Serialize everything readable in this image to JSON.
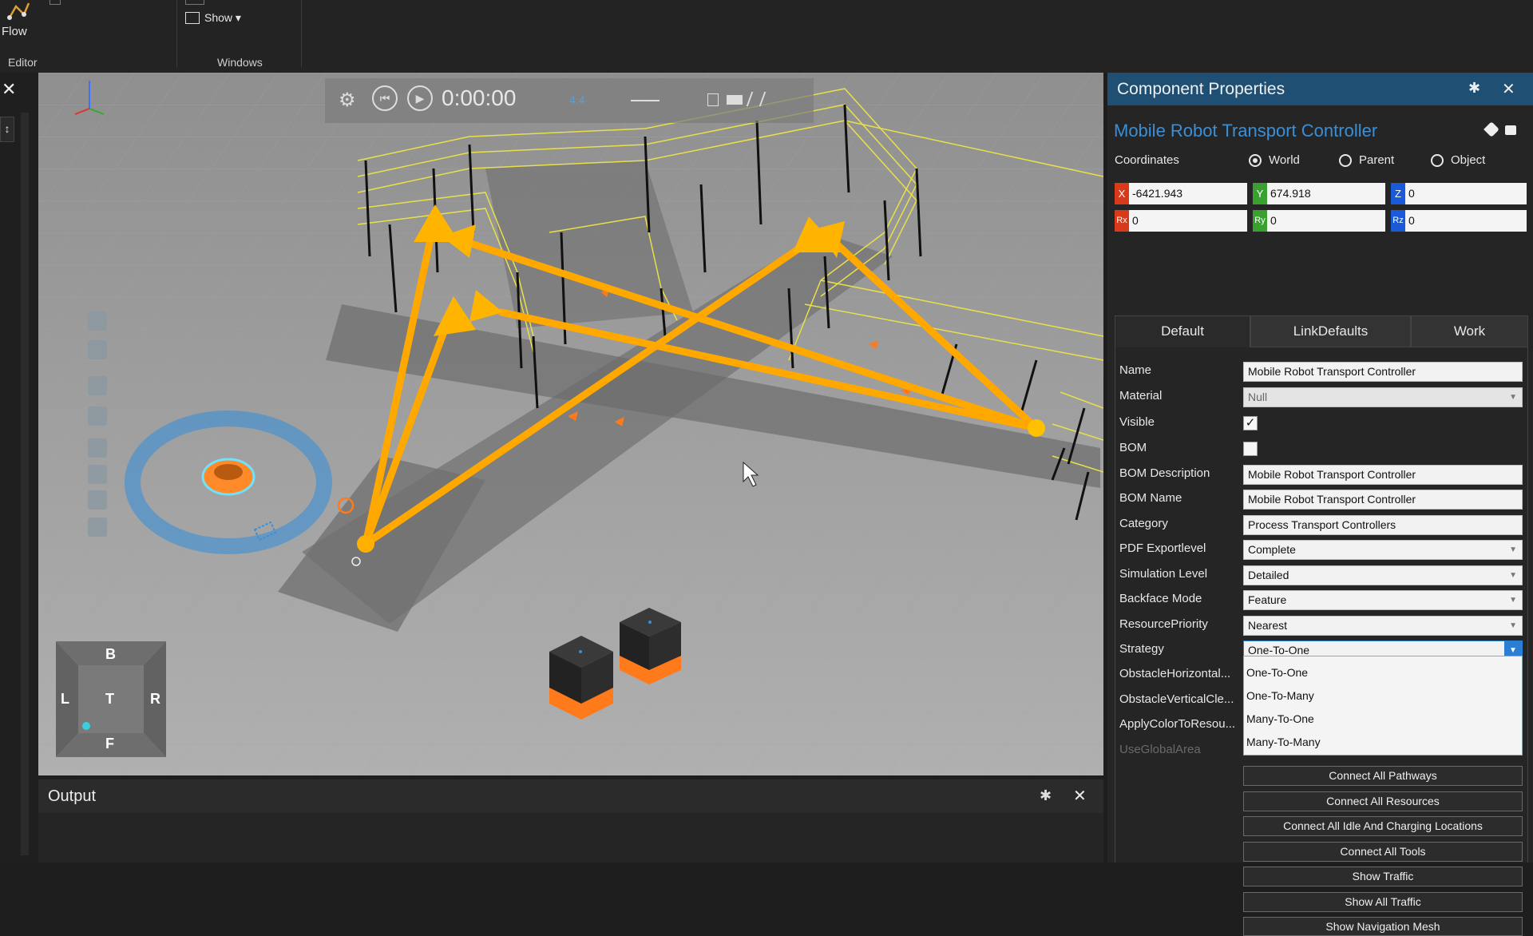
{
  "ribbon": {
    "flow_label": "Flow",
    "show_label": "Show ▾",
    "editor_group": "Editor",
    "windows_group": "Windows"
  },
  "playback": {
    "time": "0:00:00",
    "speed": "4.4"
  },
  "nav_cube": {
    "top": "B",
    "left": "L",
    "center": "T",
    "right": "R",
    "bottom": "F"
  },
  "output": {
    "title": "Output"
  },
  "props": {
    "title": "Component Properties",
    "component_name": "Mobile Robot Transport Controller",
    "coordinates_label": "Coordinates",
    "coord_modes": [
      "World",
      "Parent",
      "Object"
    ],
    "coord_selected": "World",
    "x": "-6421.943",
    "y": "674.918",
    "z": "0",
    "rx": "0",
    "ry": "0",
    "rz": "0",
    "tag_x": "X",
    "tag_y": "Y",
    "tag_z": "Z",
    "tag_rx": "Rx",
    "tag_ry": "Ry",
    "tag_rz": "Rz",
    "tabs": [
      "Default",
      "LinkDefaults",
      "Work"
    ],
    "active_tab": "Default",
    "labels": {
      "name": "Name",
      "material": "Material",
      "visible": "Visible",
      "bom": "BOM",
      "bom_description": "BOM Description",
      "bom_name": "BOM Name",
      "category": "Category",
      "pdf_exportlevel": "PDF Exportlevel",
      "simulation_level": "Simulation Level",
      "backface_mode": "Backface Mode",
      "resource_priority": "ResourcePriority",
      "strategy": "Strategy",
      "obstacle_horizontal": "ObstacleHorizontal...",
      "obstacle_vertical": "ObstacleVerticalCle...",
      "apply_color": "ApplyColorToResou...",
      "use_global_area": "UseGlobalArea"
    },
    "values": {
      "name": "Mobile Robot Transport Controller",
      "material": "Null",
      "visible": true,
      "bom": false,
      "bom_description": "Mobile Robot Transport Controller",
      "bom_name": "Mobile Robot Transport Controller",
      "category": "Process Transport Controllers",
      "pdf_exportlevel": "Complete",
      "simulation_level": "Detailed",
      "backface_mode": "Feature",
      "resource_priority": "Nearest",
      "strategy": "One-To-One"
    },
    "strategy_options": [
      "One-To-One",
      "One-To-Many",
      "Many-To-One",
      "Many-To-Many"
    ],
    "checkmark": "✓",
    "buttons": [
      "Connect All Pathways",
      "Connect All Resources",
      "Connect All Idle And Charging Locations",
      "Connect All Tools",
      "Show Traffic",
      "Show All Traffic",
      "Show Navigation Mesh"
    ]
  },
  "icons": {
    "pin": "✱",
    "close": "✕",
    "dropdown": "▼",
    "arrow": "▾",
    "gear": "⚙",
    "rewind": "⏮",
    "play": "▶"
  },
  "colors": {
    "title_bar": "#1f4f73",
    "component_name": "#3b8fd6",
    "flow_arrow": "#ffaa00",
    "fence": "#e8e04a",
    "tag_x": "#d83a1a",
    "tag_y": "#3aa030",
    "tag_z": "#1a5ad8"
  }
}
